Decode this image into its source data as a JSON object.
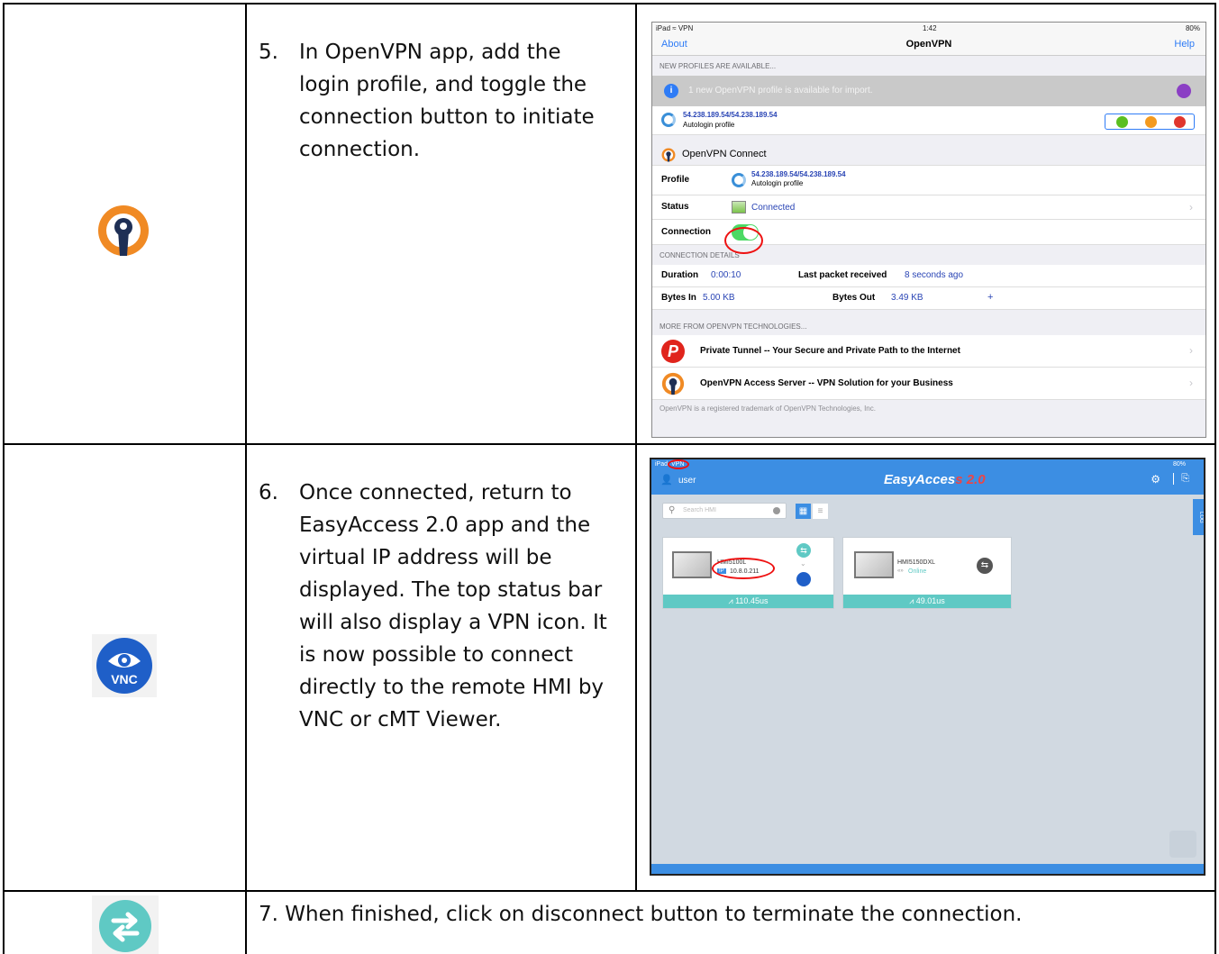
{
  "steps": [
    {
      "number": "5.",
      "lines": [
        "In OpenVPN app, add the",
        "login profile, and toggle the",
        "connection button to initiate",
        "connection."
      ]
    },
    {
      "number": "6.",
      "lines": [
        "Once connected, return to",
        "EasyAccess 2.0 app and the",
        "virtual IP address will be",
        "displayed. The top status bar",
        "will also display a VPN icon. It",
        "is now possible to connect",
        "directly to the remote HMI by",
        "VNC or cMT Viewer."
      ]
    },
    {
      "text": "7. When finished, click on disconnect button to terminate the connection."
    }
  ],
  "icons": {
    "step5": "openvpn-logo-icon",
    "step6": "vnc-eye-icon",
    "step7": "disconnect-arrows-icon",
    "vnc_label": "VNC"
  },
  "colors": {
    "openvpn_orange": "#f08a24",
    "openvpn_navy": "#1e2f55",
    "vnc_blue": "#1f5fc8",
    "teal": "#5fc9c4",
    "ea_blue": "#3c8ee3",
    "toggle_green": "#4cd964",
    "annotation_red": "#e11111"
  },
  "openvpn": {
    "statusbar": {
      "left": "iPad ≈ VPN",
      "time": "1:42",
      "battery": "80%"
    },
    "nav": {
      "about": "About",
      "title": "OpenVPN",
      "help": "Help"
    },
    "new_profiles_header": "NEW PROFILES ARE AVAILABLE...",
    "notice": "1 new OpenVPN profile is available for import.",
    "import_profile": {
      "name": "54.238.189.54/54.238.189.54",
      "sub": "Autologin profile"
    },
    "connect_header": "OpenVPN Connect",
    "profile_label": "Profile",
    "profile": {
      "name": "54.238.189.54/54.238.189.54",
      "sub": "Autologin profile"
    },
    "status_label": "Status",
    "status_value": "Connected",
    "connection_label": "Connection",
    "connection_on": true,
    "details_header": "CONNECTION DETAILS",
    "duration_label": "Duration",
    "duration_value": "0:00:10",
    "last_packet_label": "Last packet received",
    "last_packet_value": "8 seconds ago",
    "bytes_in_label": "Bytes In",
    "bytes_in_value": "5.00 KB",
    "bytes_out_label": "Bytes Out",
    "bytes_out_value": "3.49 KB",
    "plus": "+",
    "more_header": "MORE FROM OPENVPN TECHNOLOGIES...",
    "private_tunnel": "Private Tunnel -- Your Secure and Private Path to the Internet",
    "access_server": "OpenVPN Access Server -- VPN Solution for your Business",
    "footer": "OpenVPN is a registered trademark of OpenVPN Technologies, Inc."
  },
  "easyaccess": {
    "statusbar": {
      "left": "iPad",
      "vpn": "VPN",
      "battery": "80%"
    },
    "user": "user",
    "title": "EasyAcces",
    "title_suffix": "s 2.0",
    "search_placeholder": "Search HMI",
    "log_tab": "LOG",
    "devices": [
      {
        "name": "HMI5100L",
        "ip_tag": "IP",
        "ip": "10.8.0.211",
        "latency": "110.45us"
      },
      {
        "name": "HMI5150DXL",
        "status": "Online",
        "latency": "49.01us"
      }
    ]
  }
}
